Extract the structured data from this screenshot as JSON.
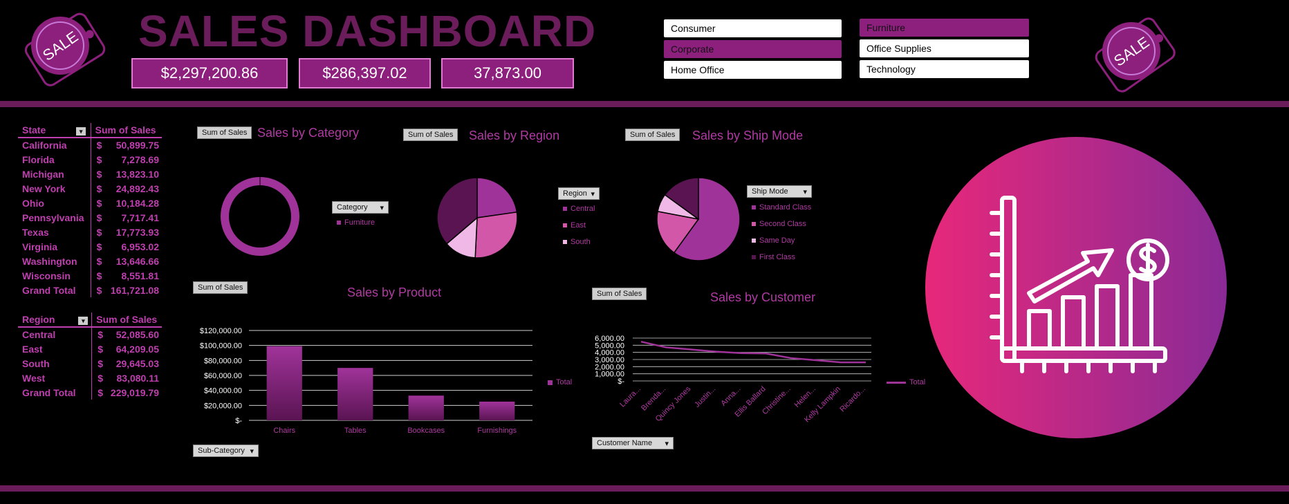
{
  "header": {
    "title": "SALES DASHBOARD",
    "kpis": [
      "$2,297,200.86",
      "$286,397.02",
      "37,873.00"
    ],
    "badge_text": "SALE"
  },
  "slicers": {
    "segment": [
      {
        "label": "Consumer",
        "selected": false
      },
      {
        "label": "Corporate",
        "selected": true
      },
      {
        "label": "Home Office",
        "selected": false
      }
    ],
    "category": [
      {
        "label": "Furniture",
        "selected": true
      },
      {
        "label": "Office Supplies",
        "selected": false
      },
      {
        "label": "Technology",
        "selected": false
      }
    ]
  },
  "state_table": {
    "col1": "State",
    "col2": "Sum of Sales",
    "rows": [
      {
        "name": "California",
        "cur": "$",
        "val": "50,899.75"
      },
      {
        "name": "Florida",
        "cur": "$",
        "val": "7,278.69"
      },
      {
        "name": "Michigan",
        "cur": "$",
        "val": "13,823.10"
      },
      {
        "name": "New York",
        "cur": "$",
        "val": "24,892.43"
      },
      {
        "name": "Ohio",
        "cur": "$",
        "val": "10,184.28"
      },
      {
        "name": "Pennsylvania",
        "cur": "$",
        "val": "7,717.41"
      },
      {
        "name": "Texas",
        "cur": "$",
        "val": "17,773.93"
      },
      {
        "name": "Virginia",
        "cur": "$",
        "val": "6,953.02"
      },
      {
        "name": "Washington",
        "cur": "$",
        "val": "13,646.66"
      },
      {
        "name": "Wisconsin",
        "cur": "$",
        "val": "8,551.81"
      },
      {
        "name": "Grand Total",
        "cur": "$",
        "val": "161,721.08"
      }
    ]
  },
  "region_table": {
    "col1": "Region",
    "col2": "Sum of Sales",
    "rows": [
      {
        "name": "Central",
        "cur": "$",
        "val": "52,085.60"
      },
      {
        "name": "East",
        "cur": "$",
        "val": "64,209.05"
      },
      {
        "name": "South",
        "cur": "$",
        "val": "29,645.03"
      },
      {
        "name": "West",
        "cur": "$",
        "val": "83,080.11"
      },
      {
        "name": "Grand Total",
        "cur": "$",
        "val": "229,019.79"
      }
    ]
  },
  "charts": {
    "sum_of_sales_chip": "Sum of Sales",
    "category": {
      "title": "Sales by Category",
      "filter": "Category",
      "legend": [
        "Furniture"
      ]
    },
    "region": {
      "title": "Sales by Region",
      "filter": "Region",
      "legend": [
        "Central",
        "East",
        "South"
      ]
    },
    "shipmode": {
      "title": "Sales by Ship Mode",
      "filter": "Ship Mode",
      "legend": [
        "Standard Class",
        "Second Class",
        "Same Day",
        "First Class"
      ]
    },
    "product": {
      "title": "Sales by Product",
      "filter": "Sub-Category",
      "legend": "Total"
    },
    "customer": {
      "title": "Sales by Customer",
      "filter": "Customer Name",
      "legend": "Total"
    }
  },
  "colors": {
    "accent": "#8d1f7d",
    "band": "#6b1c5a",
    "text": "#c03fb0",
    "pie_dark": "#5a1452",
    "pie_mid": "#a0339a",
    "pie_pink": "#d257a8",
    "pie_light": "#f0b8e6"
  },
  "chart_data": [
    {
      "type": "pie",
      "title": "Sales by Category",
      "categories": [
        "Furniture"
      ],
      "values": [
        1
      ]
    },
    {
      "type": "pie",
      "title": "Sales by Region",
      "categories": [
        "Central",
        "East",
        "South",
        "West"
      ],
      "values": [
        52085.6,
        64209.05,
        29645.03,
        83080.11
      ]
    },
    {
      "type": "pie",
      "title": "Sales by Ship Mode",
      "categories": [
        "Standard Class",
        "Second Class",
        "Same Day",
        "First Class"
      ],
      "values": [
        60,
        18,
        7,
        15
      ]
    },
    {
      "type": "bar",
      "title": "Sales by Product",
      "categories": [
        "Chairs",
        "Tables",
        "Bookcases",
        "Furnishings"
      ],
      "series": [
        {
          "name": "Total",
          "values": [
            99000,
            70000,
            33000,
            25000
          ]
        }
      ],
      "yticks": [
        "$120,000.00",
        "$100,000.00",
        "$80,000.00",
        "$60,000.00",
        "$40,000.00",
        "$20,000.00",
        "$-"
      ],
      "ylim": [
        0,
        120000
      ]
    },
    {
      "type": "line",
      "title": "Sales by Customer",
      "categories": [
        "Laura...",
        "Brenda...",
        "Quincy Jones",
        "Justin...",
        "Anna...",
        "Ellis Ballard",
        "Christine...",
        "Helen...",
        "Kelly Lampkin",
        "Ricardo..."
      ],
      "series": [
        {
          "name": "Total",
          "values": [
            5500,
            4700,
            4400,
            4100,
            3900,
            3850,
            3200,
            2900,
            2600,
            2600
          ]
        }
      ],
      "yticks": [
        "$6,000.00",
        "$5,000.00",
        "$4,000.00",
        "$3,000.00",
        "$2,000.00",
        "$1,000.00",
        "$-"
      ],
      "ylim": [
        0,
        6000
      ]
    }
  ]
}
